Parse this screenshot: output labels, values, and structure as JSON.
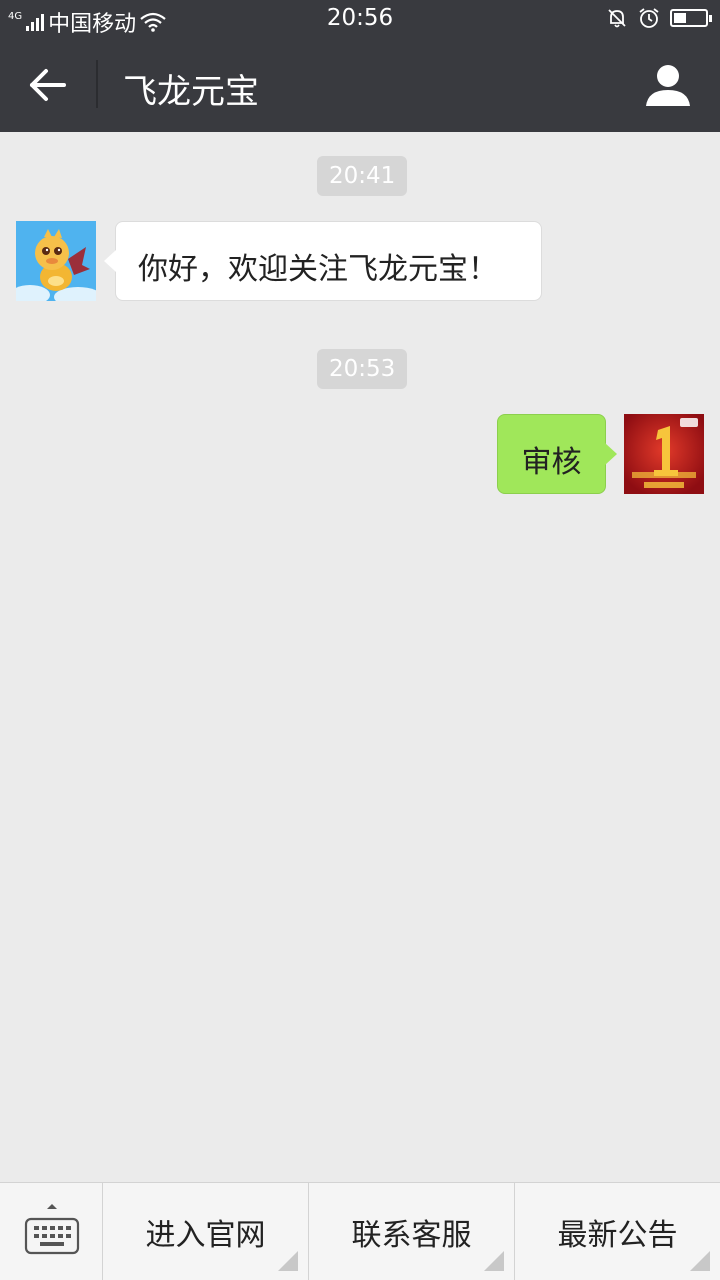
{
  "status_bar": {
    "network_type": "4G",
    "carrier": "中国移动",
    "time": "20:56",
    "battery_level": 0.35
  },
  "nav": {
    "title": "飞龙元宝",
    "back_icon": "arrow-left-icon",
    "profile_icon": "person-icon"
  },
  "chat": {
    "messages": [
      {
        "time": "20:41",
        "direction": "incoming",
        "text": "你好，欢迎关注飞龙元宝！"
      },
      {
        "time": "20:53",
        "direction": "outgoing",
        "text": "审核"
      }
    ]
  },
  "bottom_menu": {
    "keyboard_icon": "keyboard-icon",
    "items": [
      {
        "label": "进入官网"
      },
      {
        "label": "联系客服"
      },
      {
        "label": "最新公告"
      }
    ]
  },
  "colors": {
    "header_bg": "#393a3f",
    "chat_bg": "#ebebeb",
    "outgoing_bubble": "#a0e75a",
    "incoming_bubble": "#ffffff"
  }
}
